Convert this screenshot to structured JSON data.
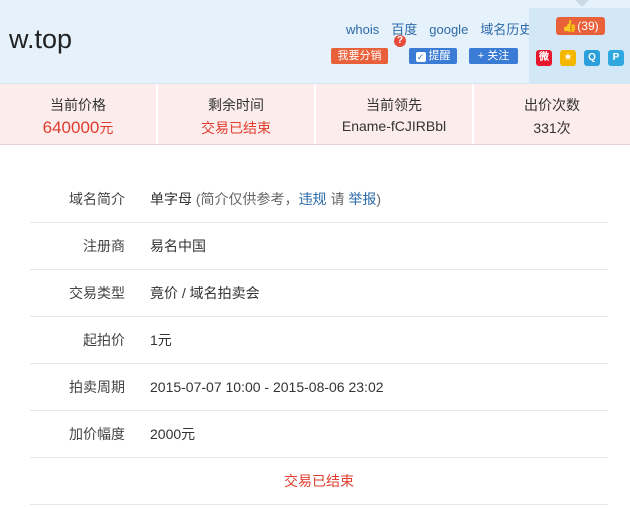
{
  "header": {
    "domain": "w.top",
    "links": [
      "whois",
      "百度",
      "google",
      "域名历史"
    ],
    "question_badge": "?",
    "share_label": "我要分销",
    "remind_label": "提醒",
    "follow_label": "+ 关注",
    "like_count": "(39)",
    "social_icons": [
      "weibo-icon",
      "qzone-icon",
      "qq-icon",
      "tencent-weibo-icon"
    ]
  },
  "stats": [
    {
      "label": "当前价格",
      "value_number": "640000",
      "value_unit": "元"
    },
    {
      "label": "剩余时间",
      "value": "交易已结束"
    },
    {
      "label": "当前领先",
      "value": "Ename-fCJIRBbl"
    },
    {
      "label": "出价次数",
      "value": "331次"
    }
  ],
  "details": {
    "intro_key": "域名简介",
    "intro_value": "单字母",
    "intro_note_open": "(简介仅供参考，",
    "intro_violation": "违规",
    "intro_please": " 请 ",
    "intro_report": "举报",
    "intro_close": ")",
    "registrar_key": "注册商",
    "registrar_value": "易名中国",
    "type_key": "交易类型",
    "type_value": "竟价 / 域名拍卖会",
    "start_key": "起拍价",
    "start_value": "1元",
    "period_key": "拍卖周期",
    "period_value": "2015-07-07 10:00 - 2015-08-06 23:02",
    "increment_key": "加价幅度",
    "increment_value": "2000元",
    "status_text": "交易已结束"
  },
  "colors": {
    "header_bg": "#e5f1fb",
    "stats_bg": "#fcecec",
    "accent_red": "#e03d2e",
    "link_blue": "#2c6aa8",
    "button_orange": "#e8613a",
    "button_blue": "#3a7bd5"
  }
}
